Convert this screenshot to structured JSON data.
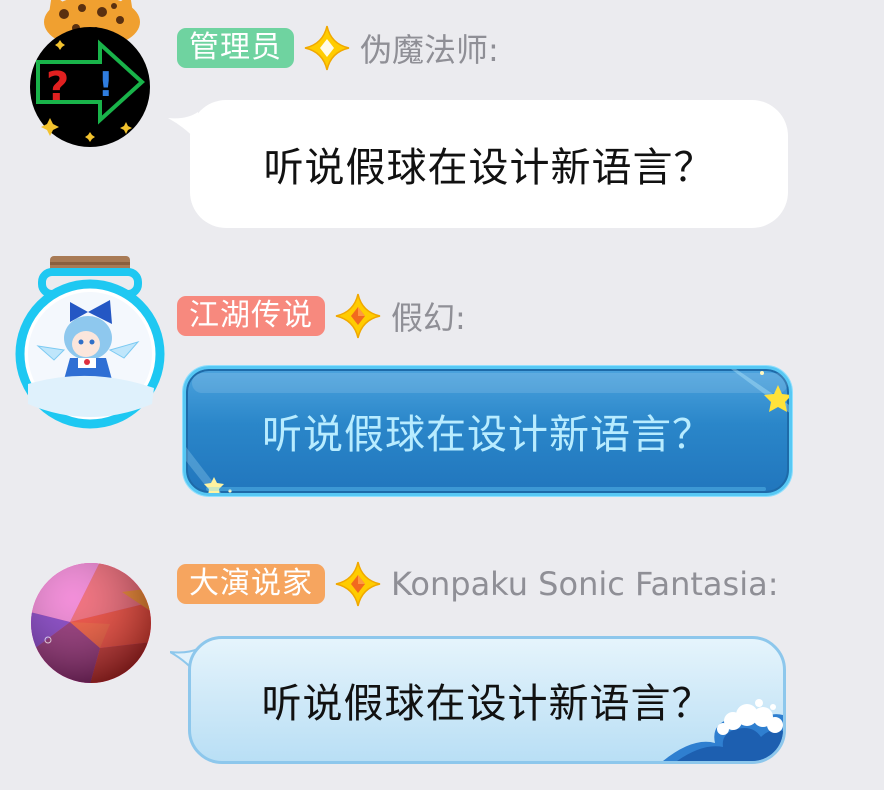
{
  "colors": {
    "background": "#ebebef",
    "badge_admin": "#6fd3a0",
    "badge_legend": "#f7897e",
    "badge_speaker": "#f6a55f",
    "name_text": "#8f8f96",
    "diamond": "#ffcc00"
  },
  "messages": [
    {
      "id": "msg-1",
      "badge": "管理员",
      "badge_icon": "diamond-icon",
      "sender": "伪魔法师:",
      "text": "听说假球在设计新语言？",
      "bubble_style": "white",
      "avatar": "question-exclaim-arrow-avatar"
    },
    {
      "id": "msg-2",
      "badge": "江湖传说",
      "badge_icon": "diamond-icon",
      "sender": "假幻:",
      "text": "听说假球在设计新语言？",
      "bubble_style": "blue-starry",
      "avatar": "bottle-fairy-avatar"
    },
    {
      "id": "msg-3",
      "badge": "大演说家",
      "badge_icon": "diamond-icon",
      "sender": "Konpaku Sonic Fantasia:",
      "text": "听说假球在设计新语言？",
      "bubble_style": "light-blue-wave",
      "avatar": "color-sphere-avatar"
    }
  ]
}
